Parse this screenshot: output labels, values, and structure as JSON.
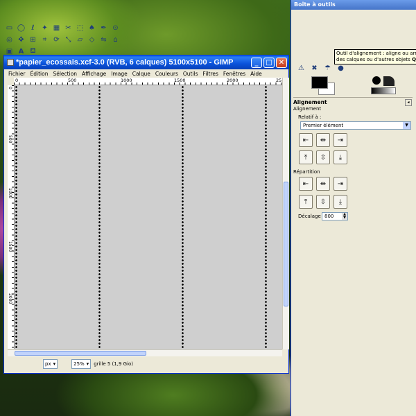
{
  "image_window": {
    "title": "*papier_ecossais.xcf-3.0 (RVB, 6 calques) 5100x5100 - GIMP",
    "menu": [
      "Fichier",
      "Édition",
      "Sélection",
      "Affichage",
      "Image",
      "Calque",
      "Couleurs",
      "Outils",
      "Filtres",
      "Fenêtres",
      "Aide"
    ],
    "ruler_labels": [
      "0",
      "500",
      "1000",
      "1500",
      "2000",
      "25"
    ],
    "status": {
      "unit": "px",
      "zoom": "25%",
      "info": "grille 5 (1,9 Gio)"
    }
  },
  "toolbox": {
    "title": "Boîte à outils",
    "tooltip_line1": "Outil d'alignement : aligne ou arrange",
    "tooltip_line2": "des calques ou d'autres objets",
    "tooltip_key": "Q"
  },
  "alignment_panel": {
    "header": "Alignement",
    "section_align": "Alignement",
    "relative_label": "Relatif à :",
    "relative_value": "Premier élément",
    "section_distribute": "Répartition",
    "offset_label": "Décalage :",
    "offset_value": "800"
  },
  "colors": {
    "titlebar": "#0a52db",
    "foreground": "#000000",
    "background": "#ffffff",
    "canvas": "#cfcfcf"
  }
}
